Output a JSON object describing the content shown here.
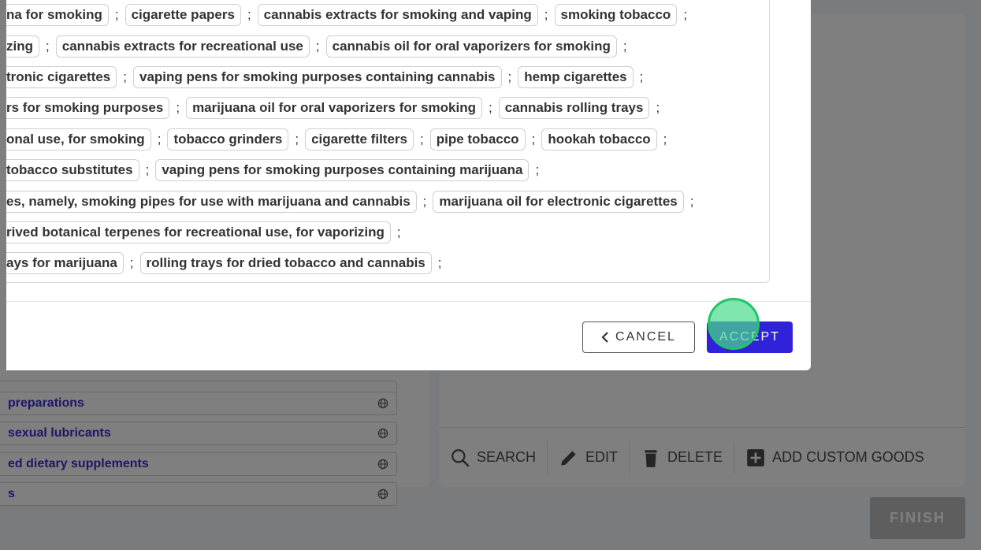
{
  "modal": {
    "term_rows": [
      [
        "na for smoking",
        "cigarette papers",
        "cannabis extracts for smoking and vaping",
        "smoking tobacco"
      ],
      [
        "zing",
        "cannabis extracts for recreational use",
        "cannabis oil for oral vaporizers for smoking"
      ],
      [
        "tronic cigarettes",
        "vaping pens for smoking purposes containing cannabis",
        "hemp cigarettes"
      ],
      [
        "rs for smoking purposes",
        "marijuana oil for oral vaporizers for smoking",
        "cannabis rolling trays"
      ],
      [
        "onal use, for smoking",
        "tobacco grinders",
        "cigarette filters",
        "pipe tobacco",
        "hookah tobacco"
      ],
      [
        "tobacco substitutes",
        "vaping pens for smoking purposes containing marijuana"
      ],
      [
        "es, namely, smoking pipes for use with marijuana and cannabis",
        "marijuana oil for electronic cigarettes"
      ],
      [
        "rived botanical terpenes for recreational use, for vaporizing"
      ],
      [
        "ays for marijuana",
        "rolling trays for dried tobacco and cannabis"
      ]
    ],
    "separator": ";",
    "cancel_label": "CANCEL",
    "accept_label": "ACCEPT"
  },
  "background": {
    "list_items": [
      {
        "label": "preparations"
      },
      {
        "label": "sexual lubricants"
      },
      {
        "label": "ed dietary supplements"
      },
      {
        "label": "s"
      }
    ],
    "toolbar": {
      "search_label": "SEARCH",
      "edit_label": "EDIT",
      "delete_label": "DELETE",
      "add_label": "ADD CUSTOM GOODS"
    },
    "finish_label": "FINISH"
  },
  "colors": {
    "accent": "#2f22d9",
    "link": "#3b2fd0",
    "click_marker": "#48dc8c"
  }
}
